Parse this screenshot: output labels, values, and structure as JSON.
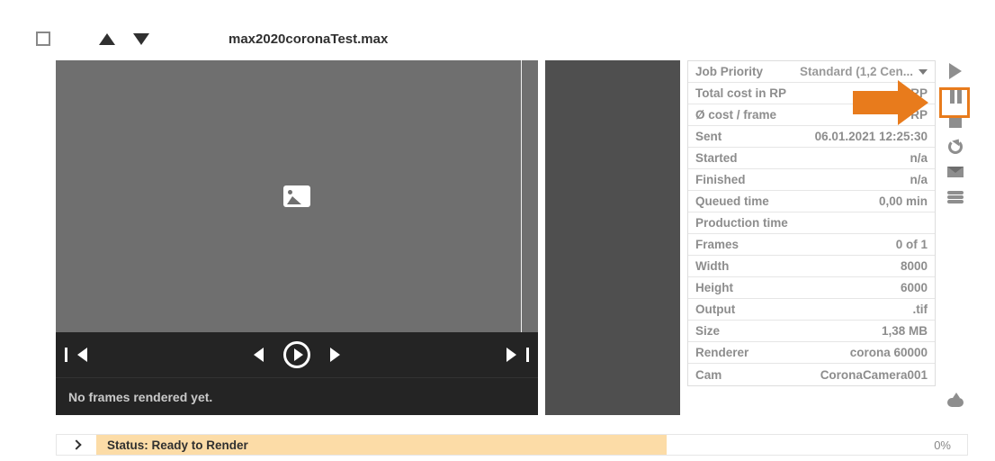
{
  "file": {
    "name": "max2020coronaTest.max"
  },
  "preview": {
    "no_frames_msg": "No frames rendered yet."
  },
  "details": {
    "rows": [
      {
        "label": "Job Priority",
        "value": "Standard (1,2 Cen..."
      },
      {
        "label": "Total cost in RP",
        "value": "RP"
      },
      {
        "label": "Ø cost / frame",
        "value": "RP"
      },
      {
        "label": "Sent",
        "value": "06.01.2021 12:25:30"
      },
      {
        "label": "Started",
        "value": "n/a"
      },
      {
        "label": "Finished",
        "value": "n/a"
      },
      {
        "label": "Queued time",
        "value": "0,00 min"
      },
      {
        "label": "Production time",
        "value": ""
      },
      {
        "label": "Frames",
        "value": "0 of 1"
      },
      {
        "label": "Width",
        "value": "8000"
      },
      {
        "label": "Height",
        "value": "6000"
      },
      {
        "label": "Output",
        "value": ".tif"
      },
      {
        "label": "Size",
        "value": "1,38 MB"
      },
      {
        "label": "Renderer",
        "value": "corona 60000"
      },
      {
        "label": "Cam",
        "value": "CoronaCamera001"
      }
    ]
  },
  "status_bar": {
    "label": "Status: Ready to Render",
    "percent": "0%"
  }
}
